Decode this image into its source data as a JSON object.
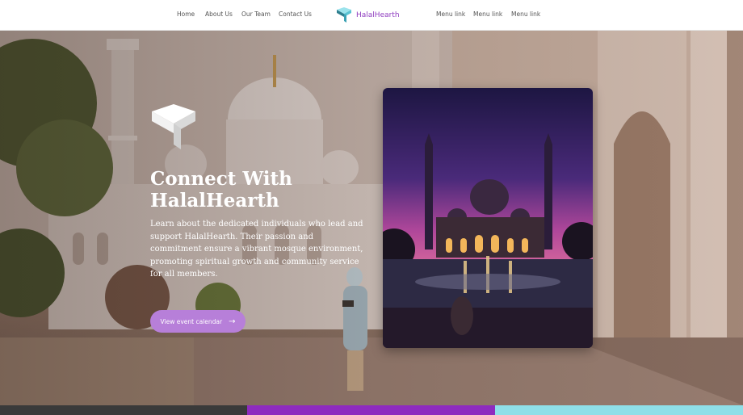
{
  "nav": {
    "left_links": [
      "Home",
      "About Us",
      "Our Team",
      "Contact Us"
    ],
    "brand": "HalalHearth",
    "right_links": [
      "Menu link",
      "Menu link",
      "Menu link"
    ]
  },
  "hero": {
    "title": "Connect With HalalHearth",
    "description": "Learn about the dedicated individuals who lead and support HalalHearth. Their passion and commitment ensure a vibrant mosque environment, promoting spiritual growth and community service for all members.",
    "cta_label": "View event calendar",
    "cta_icon": "arrow-right-icon"
  },
  "colors": {
    "brand_purple": "#8e3bbf",
    "cta_purple": "#b77fd9",
    "strip": [
      "#3a3a3a",
      "#8e2bbf",
      "#8fdfe8"
    ]
  }
}
